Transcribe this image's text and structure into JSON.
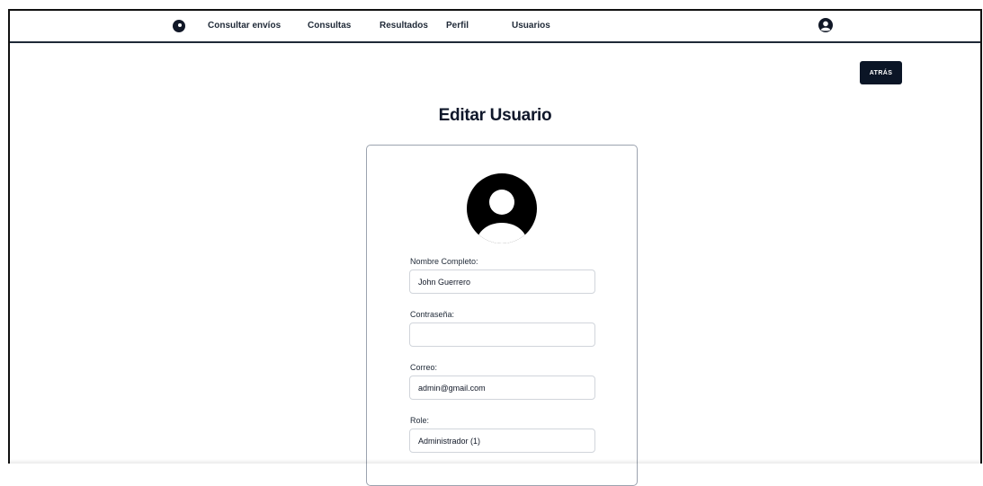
{
  "nav": {
    "items": [
      {
        "label": "Consultar envíos"
      },
      {
        "label": "Consultas"
      },
      {
        "label": "Resultados"
      },
      {
        "label": "Perfil"
      },
      {
        "label": "Usuarios"
      }
    ]
  },
  "back_button": {
    "label": "ATRÁS"
  },
  "page": {
    "title": "Editar Usuario"
  },
  "form": {
    "full_name": {
      "label": "Nombre Completo:",
      "value": "John Guerrero"
    },
    "password": {
      "label": "Contraseña:",
      "value": ""
    },
    "email": {
      "label": "Correo:",
      "value": "admin@gmail.com"
    },
    "role": {
      "label": "Role:",
      "value": "Administrador (1)"
    }
  },
  "icons": {
    "logo": "logo-icon",
    "nav_avatar": "user-avatar-icon",
    "profile_avatar": "profile-avatar-icon"
  },
  "colors": {
    "primary": "#0b1526",
    "nav_border": "#1f2937",
    "card_border": "#9ca3af"
  }
}
